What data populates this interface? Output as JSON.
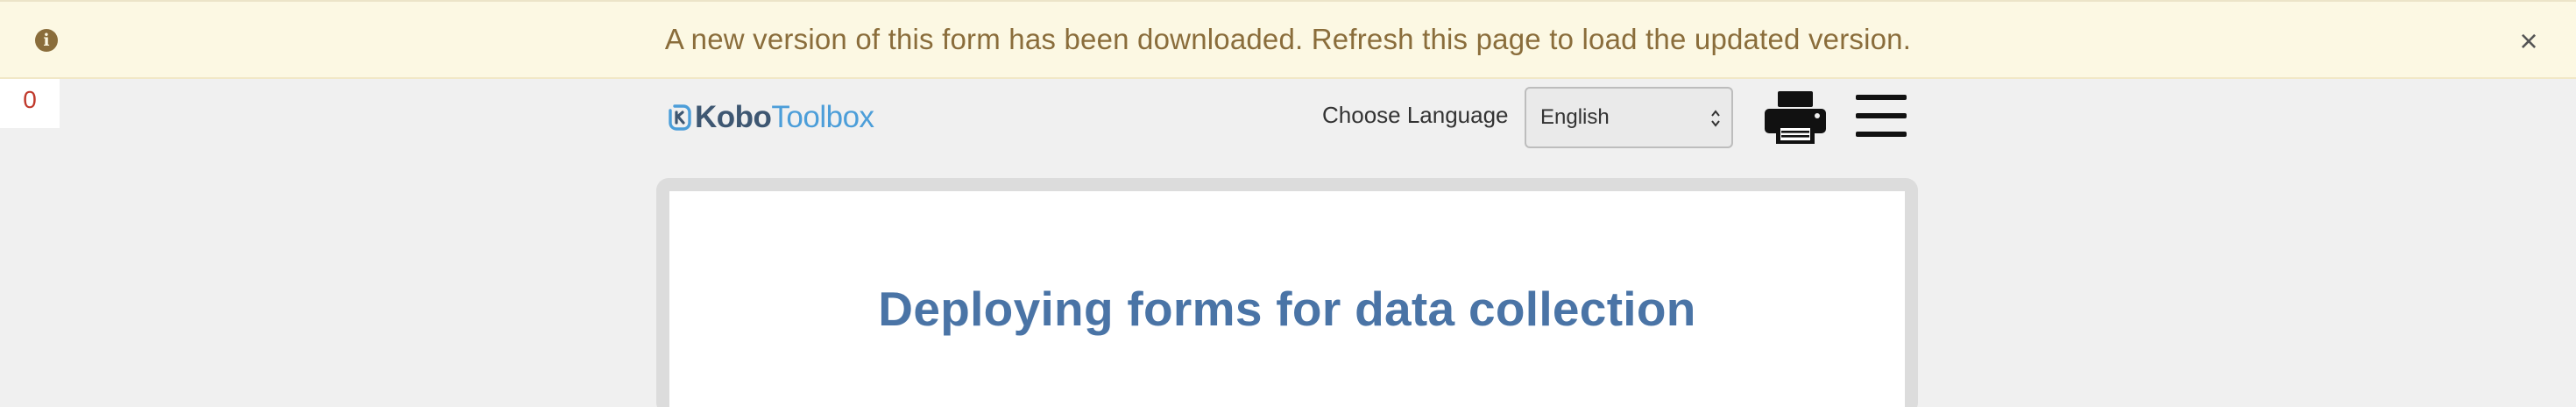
{
  "banner": {
    "message": "A new version of this form has been downloaded. Refresh this page to load the updated version.",
    "info_icon": "i",
    "close_label": "×",
    "colors": {
      "background": "#fcf8e3",
      "text": "#8a6d3b"
    }
  },
  "counter": {
    "value": "0"
  },
  "header": {
    "logo": {
      "part1": "Kobo",
      "part2": "Toolbox"
    },
    "language_label": "Choose Language",
    "language_selected": "English"
  },
  "form": {
    "title": "Deploying forms for data collection",
    "title_color": "#4a74a6"
  },
  "icons": [
    "info-icon",
    "close-icon",
    "kobo-logo-icon",
    "chevron-updown-icon",
    "print-icon",
    "hamburger-menu-icon"
  ]
}
